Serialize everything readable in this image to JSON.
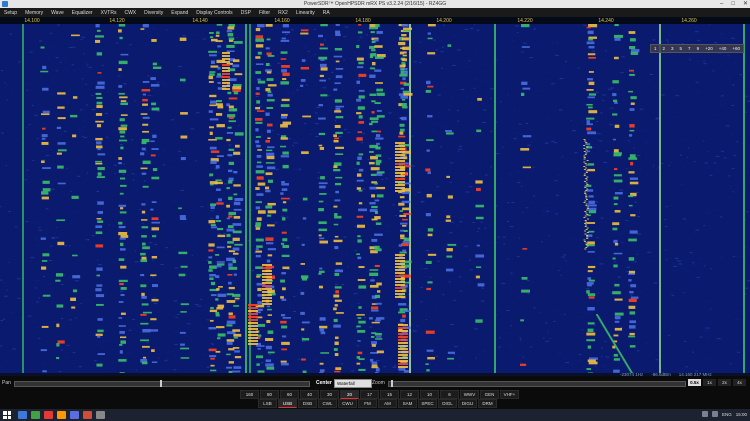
{
  "window": {
    "title": "PowerSDR™ OpenHPSDR mRX PS v3.2.24 (2/16/15)   -   RZ4GG",
    "controls": [
      "–",
      "□",
      "✕"
    ]
  },
  "menu": [
    "Setup",
    "Memory",
    "Wave",
    "Equalizer",
    "XVTRs",
    "CWX",
    "Diversity",
    "Expand",
    "Display Controls",
    "DSP",
    "Filter",
    "RX2",
    "Linearity",
    "RA"
  ],
  "freq_axis": {
    "labels": [
      "14.100",
      "14.120",
      "14.140",
      "14.160",
      "14.180",
      "14.200",
      "14.220",
      "14.240",
      "14.260"
    ],
    "color": "#e3c84b"
  },
  "waterfall": {
    "overlay_buttons": [
      "1",
      "2",
      "3",
      "5",
      "7",
      "9",
      "+20",
      "+40",
      "+60"
    ],
    "status_left": "-23074 1Hz",
    "status_mid": "-86.6dBm",
    "status_right": "14.160 217 MHz",
    "colors": {
      "bg": "#0a1a6e",
      "signal": "#f0c040",
      "peak": "#ff4020",
      "mid": "#3bbf6a"
    }
  },
  "controls": {
    "pan_label": "Pan",
    "center_label": "Center",
    "display_mode": "Waterfall",
    "zoom_label": "Zoom",
    "zoom_buttons": [
      "0.5x",
      "1x",
      "2x",
      "4x"
    ],
    "zoom_active": "0.5x"
  },
  "bands": [
    "160",
    "80",
    "60",
    "40",
    "30",
    "20",
    "17",
    "15",
    "12",
    "10",
    "6",
    "WWV",
    "GEN",
    "VHF+"
  ],
  "band_active": "20",
  "modes": [
    "LSB",
    "USB",
    "DSB",
    "CWL",
    "CWU",
    "FM",
    "AM",
    "SAM",
    "SPEC",
    "DIGL",
    "DIGU",
    "DRM"
  ],
  "mode_active": "USB",
  "taskbar": {
    "language": "ENG",
    "time": "15:00",
    "app_icons": [
      "start-icon",
      "file-explorer-icon",
      "chrome-icon",
      "opera-icon",
      "media-icon",
      "powersdr-icon",
      "app-icon",
      "app-icon"
    ],
    "app_colors": [
      "#3b78d8",
      "#43a047",
      "#e53935",
      "#ff9800",
      "#5b6ee1",
      "#d04d3c",
      "#888888"
    ]
  }
}
